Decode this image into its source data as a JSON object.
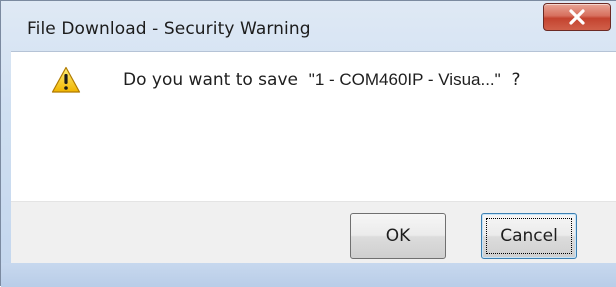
{
  "window": {
    "title": "File Download - Security Warning",
    "close_icon": "close-icon"
  },
  "dialog": {
    "icon": "warning-icon",
    "prompt_prefix": "Do you want to save",
    "file_name": "\"1 - COM460IP - Visua...\"",
    "prompt_suffix": "?"
  },
  "buttons": {
    "ok_label": "OK",
    "cancel_label": "Cancel"
  },
  "colors": {
    "close_button": "#c4432f",
    "warning_yellow": "#f5c400",
    "focus_border": "#3c7fb1"
  }
}
